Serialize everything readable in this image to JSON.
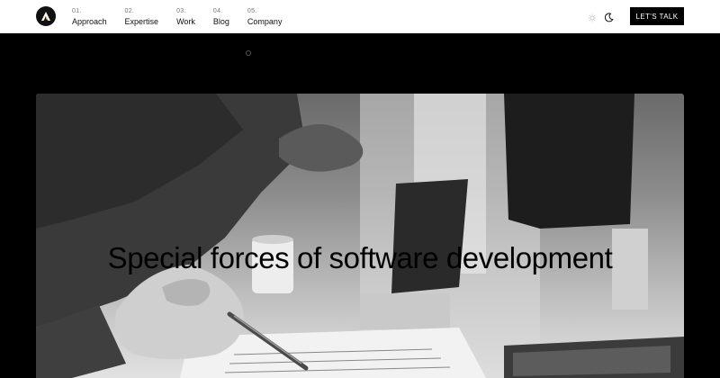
{
  "header": {
    "nav": [
      {
        "num": "01.",
        "label": "Approach"
      },
      {
        "num": "02.",
        "label": "Expertise"
      },
      {
        "num": "03.",
        "label": "Work"
      },
      {
        "num": "04.",
        "label": "Blog"
      },
      {
        "num": "05.",
        "label": "Company"
      }
    ],
    "cta_label": "LET'S TALK",
    "theme_icons": [
      "sun-icon",
      "moon-icon"
    ],
    "logo_icon": "logo-a-icon"
  },
  "hero": {
    "title": "Special forces of software development",
    "image": "grayscale photo of people working at desk with laptop and monitor"
  },
  "colors": {
    "header_bg": "#ffffff",
    "page_bg": "#000000",
    "cta_bg": "#000000",
    "logo_accent": "#f0b400"
  }
}
